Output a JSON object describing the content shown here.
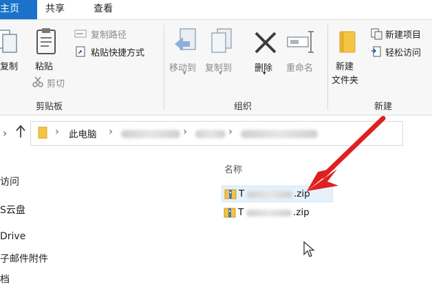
{
  "tabs": [
    "主页",
    "共享",
    "查看"
  ],
  "clipboard": {
    "copy_label": "复制",
    "paste_label": "粘贴",
    "copy_path_label": "复制路径",
    "paste_shortcut_label": "粘贴快捷方式",
    "cut_label": "剪切",
    "group_label": "剪贴板"
  },
  "organize": {
    "move_to_label": "移动到",
    "copy_to_label": "复制到",
    "delete_label": "删除",
    "rename_label": "重命名",
    "group_label": "组织"
  },
  "new": {
    "new_folder_line1": "新建",
    "new_folder_line2": "文件夹",
    "new_item_label": "新建项目",
    "easy_access_label": "轻松访问",
    "group_label": "新建"
  },
  "address": {
    "this_pc": "此电脑",
    "sep": "›"
  },
  "nav_items": [
    "访问",
    "S云盘",
    "Drive",
    "子邮件附件",
    "档"
  ],
  "file_list": {
    "column_name": "名称",
    "files": [
      {
        "prefix": "T",
        "ext": ".zip"
      },
      {
        "prefix": "T",
        "ext": ".zip"
      }
    ]
  },
  "colors": {
    "active_tab": "#1a73c8",
    "selection": "#e5f1fb",
    "arrow": "#e02020",
    "folder": "#f4c544"
  }
}
